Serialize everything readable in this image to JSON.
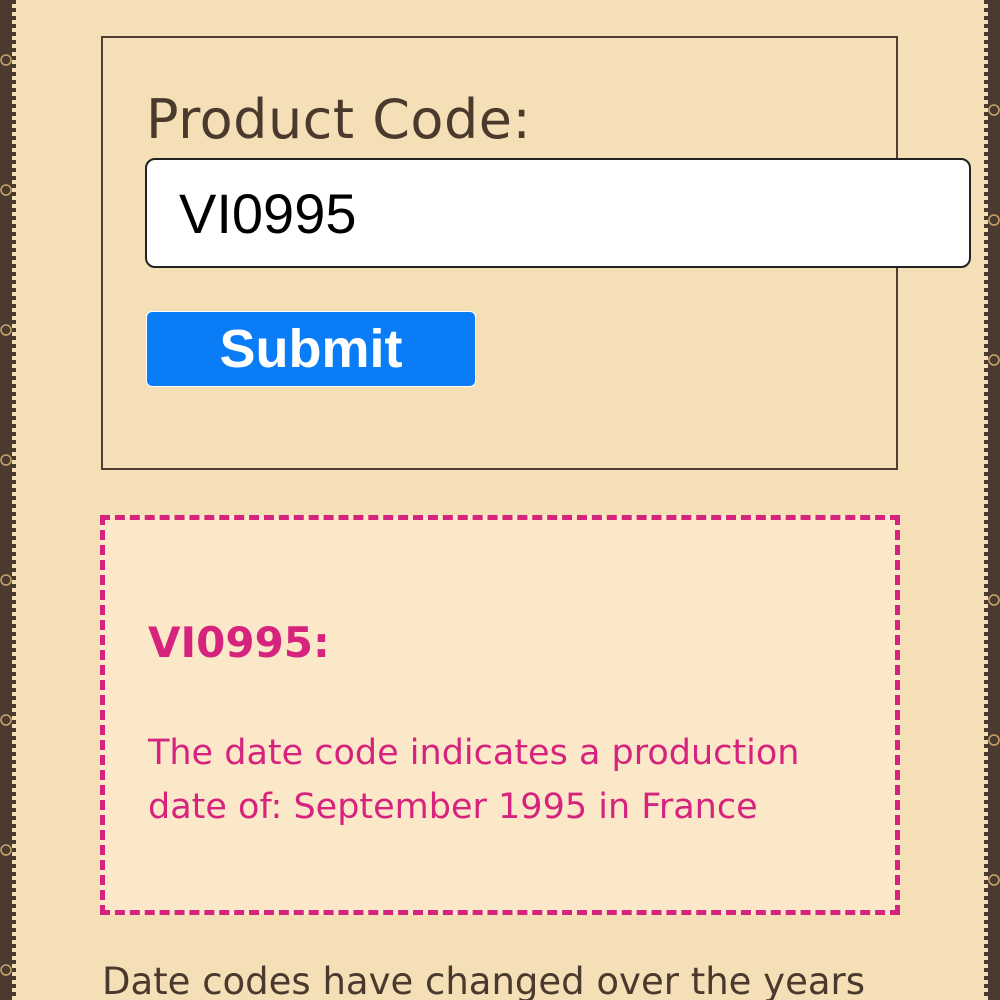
{
  "form": {
    "label": "Product Code:",
    "input_value": "VI0995",
    "submit_label": "Submit"
  },
  "result": {
    "code": "VI0995:",
    "message": "The date code indicates a production date of: September 1995 in France"
  },
  "footer": {
    "text": "Date codes have changed over the years"
  },
  "icons": {
    "side_pattern": "monogram-pattern-icon"
  },
  "colors": {
    "background": "#f4dfb6",
    "border_dark": "#4a3a30",
    "accent_pink": "#d6247e",
    "button_blue": "#0a7cf5"
  }
}
